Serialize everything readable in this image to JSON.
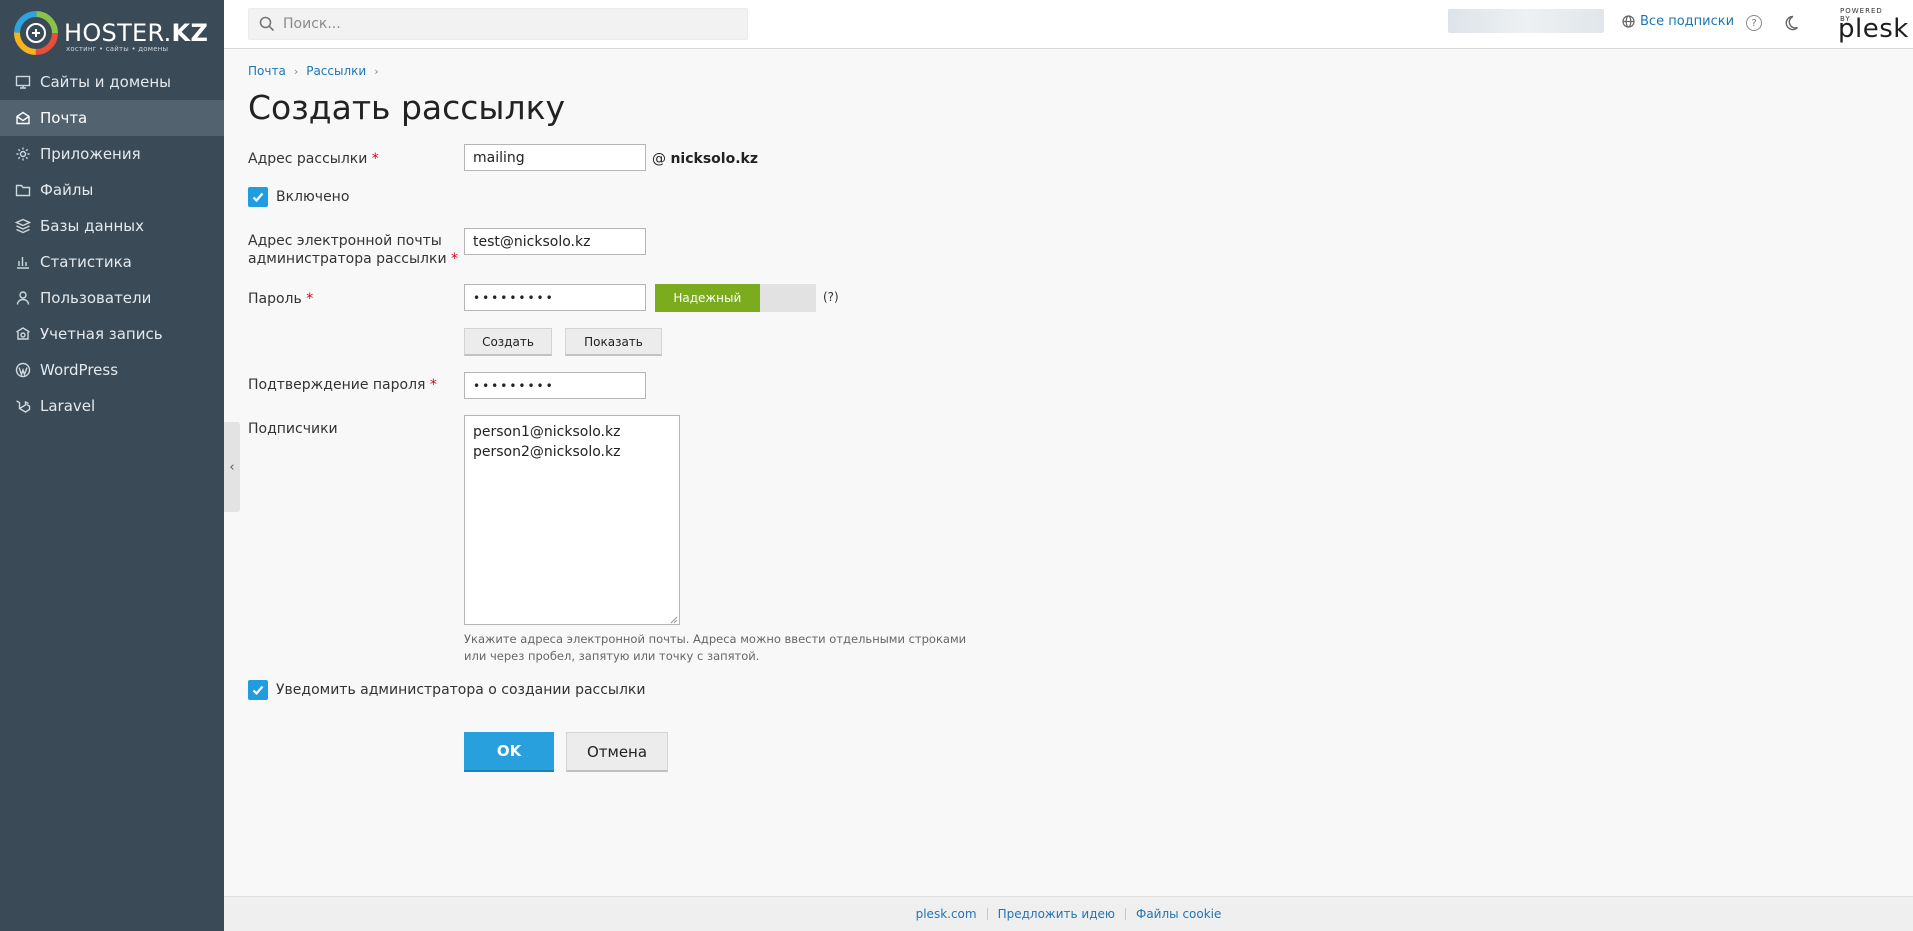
{
  "brand": {
    "name_left": "HOSTER.",
    "name_right": "KZ",
    "tagline": "хостинг • сайты • домены"
  },
  "sidebar": {
    "items": [
      {
        "label": "Сайты и домены",
        "icon": "monitor-icon"
      },
      {
        "label": "Почта",
        "icon": "mail-icon",
        "active": true
      },
      {
        "label": "Приложения",
        "icon": "gear-icon"
      },
      {
        "label": "Файлы",
        "icon": "folder-icon"
      },
      {
        "label": "Базы данных",
        "icon": "database-icon"
      },
      {
        "label": "Статистика",
        "icon": "bar-chart-icon"
      },
      {
        "label": "Пользователи",
        "icon": "user-icon"
      },
      {
        "label": "Учетная запись",
        "icon": "account-icon"
      },
      {
        "label": "WordPress",
        "icon": "wordpress-icon"
      },
      {
        "label": "Laravel",
        "icon": "laravel-icon"
      }
    ]
  },
  "header": {
    "search_placeholder": "Поиск...",
    "all_subscriptions": "Все подписки",
    "help": "?",
    "powered_by": "POWERED BY",
    "plesk": "plesk"
  },
  "breadcrumb": [
    "Почта",
    "Рассылки"
  ],
  "page_title": "Создать рассылку",
  "form": {
    "address_label": "Адрес рассылки",
    "address_value": "mailing",
    "at": "@",
    "domain": "nicksolo.kz",
    "enabled_label": "Включено",
    "admin_email_label_1": "Адрес электронной почты",
    "admin_email_label_2": "администратора рассылки",
    "admin_email_value": "test@nicksolo.kz",
    "password_label": "Пароль",
    "password_value": "•••••••••",
    "strength_label": "Надежный",
    "strength_level": 0.65,
    "password_help": "(?)",
    "generate_button": "Создать",
    "show_button": "Показать",
    "confirm_label": "Подтверждение пароля",
    "confirm_value": "•••••••••",
    "subscribers_label": "Подписчики",
    "subscribers_value": "person1@nicksolo.kz\nperson2@nicksolo.kz",
    "subscribers_help": "Укажите адреса электронной почты. Адреса можно ввести отдельными строками или через пробел, запятую или точку с запятой.",
    "notify_label": "Уведомить администратора о создании рассылки",
    "required_mark": "*",
    "ok_button": "OK",
    "cancel_button": "Отмена"
  },
  "footer": {
    "links": [
      "plesk.com",
      "Предложить идею",
      "Файлы cookie"
    ]
  },
  "colors": {
    "sidebar_bg": "#3a4a57",
    "sidebar_active": "#52636f",
    "accent": "#28a0dd",
    "link": "#1f75b5",
    "strength_good": "#7aac1e",
    "required": "#d0021b"
  }
}
